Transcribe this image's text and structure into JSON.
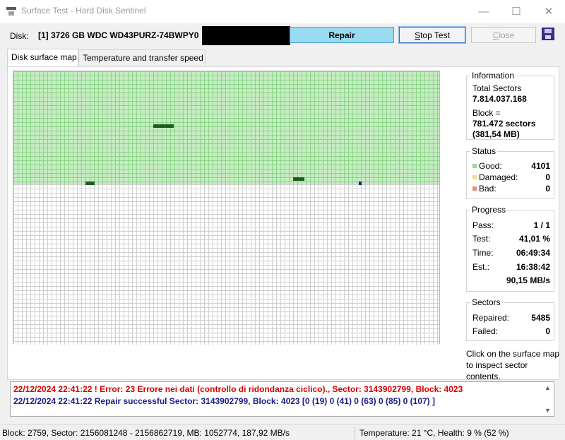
{
  "window": {
    "title": "Surface Test - Hard Disk Sentinel",
    "icon": "hdd-app-icon",
    "controls": {
      "minimize": "—",
      "maximize": "☐",
      "close": "✕"
    }
  },
  "toolbar": {
    "disk_label": "Disk:",
    "disk_value": "[1] 3726 GB  WDC WD43PURZ-74BWPY0",
    "repair_label": "Repair",
    "stop_label": "Stop Test",
    "close_label": "Close",
    "save_icon": "floppy-save-icon"
  },
  "tabs": [
    {
      "label": "Disk surface map",
      "active": true
    },
    {
      "label": "Temperature and transfer speed",
      "active": false
    }
  ],
  "information": {
    "title": "Information",
    "total_sectors_label": "Total Sectors",
    "total_sectors_value": "7.814.037.168",
    "block_label": "Block =",
    "block_sectors": "781.472 sectors",
    "block_size": "(381,54 MB)"
  },
  "status": {
    "title": "Status",
    "good_label": "Good:",
    "good_value": "4101",
    "damaged_label": "Damaged:",
    "damaged_value": "0",
    "bad_label": "Bad:",
    "bad_value": "0",
    "colors": {
      "good": "#9ad89a",
      "damaged": "#e6e48a",
      "bad": "#e88a8a"
    }
  },
  "progress": {
    "title": "Progress",
    "pass_label": "Pass:",
    "pass_value": "1 / 1",
    "test_label": "Test:",
    "test_value": "41,01 %",
    "time_label": "Time:",
    "time_value": "06:49:34",
    "est_label": "Est.:",
    "est_value": "16:38:42",
    "speed_value": "90,15 MB/s"
  },
  "sectors": {
    "title": "Sectors",
    "repaired_label": "Repaired:",
    "repaired_value": "5485",
    "failed_label": "Failed:",
    "failed_value": "0"
  },
  "hint": "Click on the surface map to inspect sector contents.",
  "log": [
    {
      "type": "error",
      "text": "22/12/2024  22:41:22 ! Error: 23 Errore nei dati (controllo di ridondanza ciclico)., Sector: 3143902799, Block: 4023"
    },
    {
      "type": "success",
      "text": "22/12/2024  22:41:22    Repair successful  Sector: 3143902799, Block: 4023  [0 (19) 0 (41) 0 (63) 0 (85) 0 (107) ]"
    }
  ],
  "statusbar": {
    "left": "Block: 2759, Sector: 2156081248 - 2156862719, MB: 1052774, 187,92 MB/s",
    "right": "Temperature: 21  °C,  Health: 9 % (52 %)"
  },
  "map": {
    "legend_colors": {
      "good": "#c6ecc2",
      "repaired": "#1f5c1f",
      "current": "#1a2470",
      "untested": "#ffffff"
    }
  }
}
